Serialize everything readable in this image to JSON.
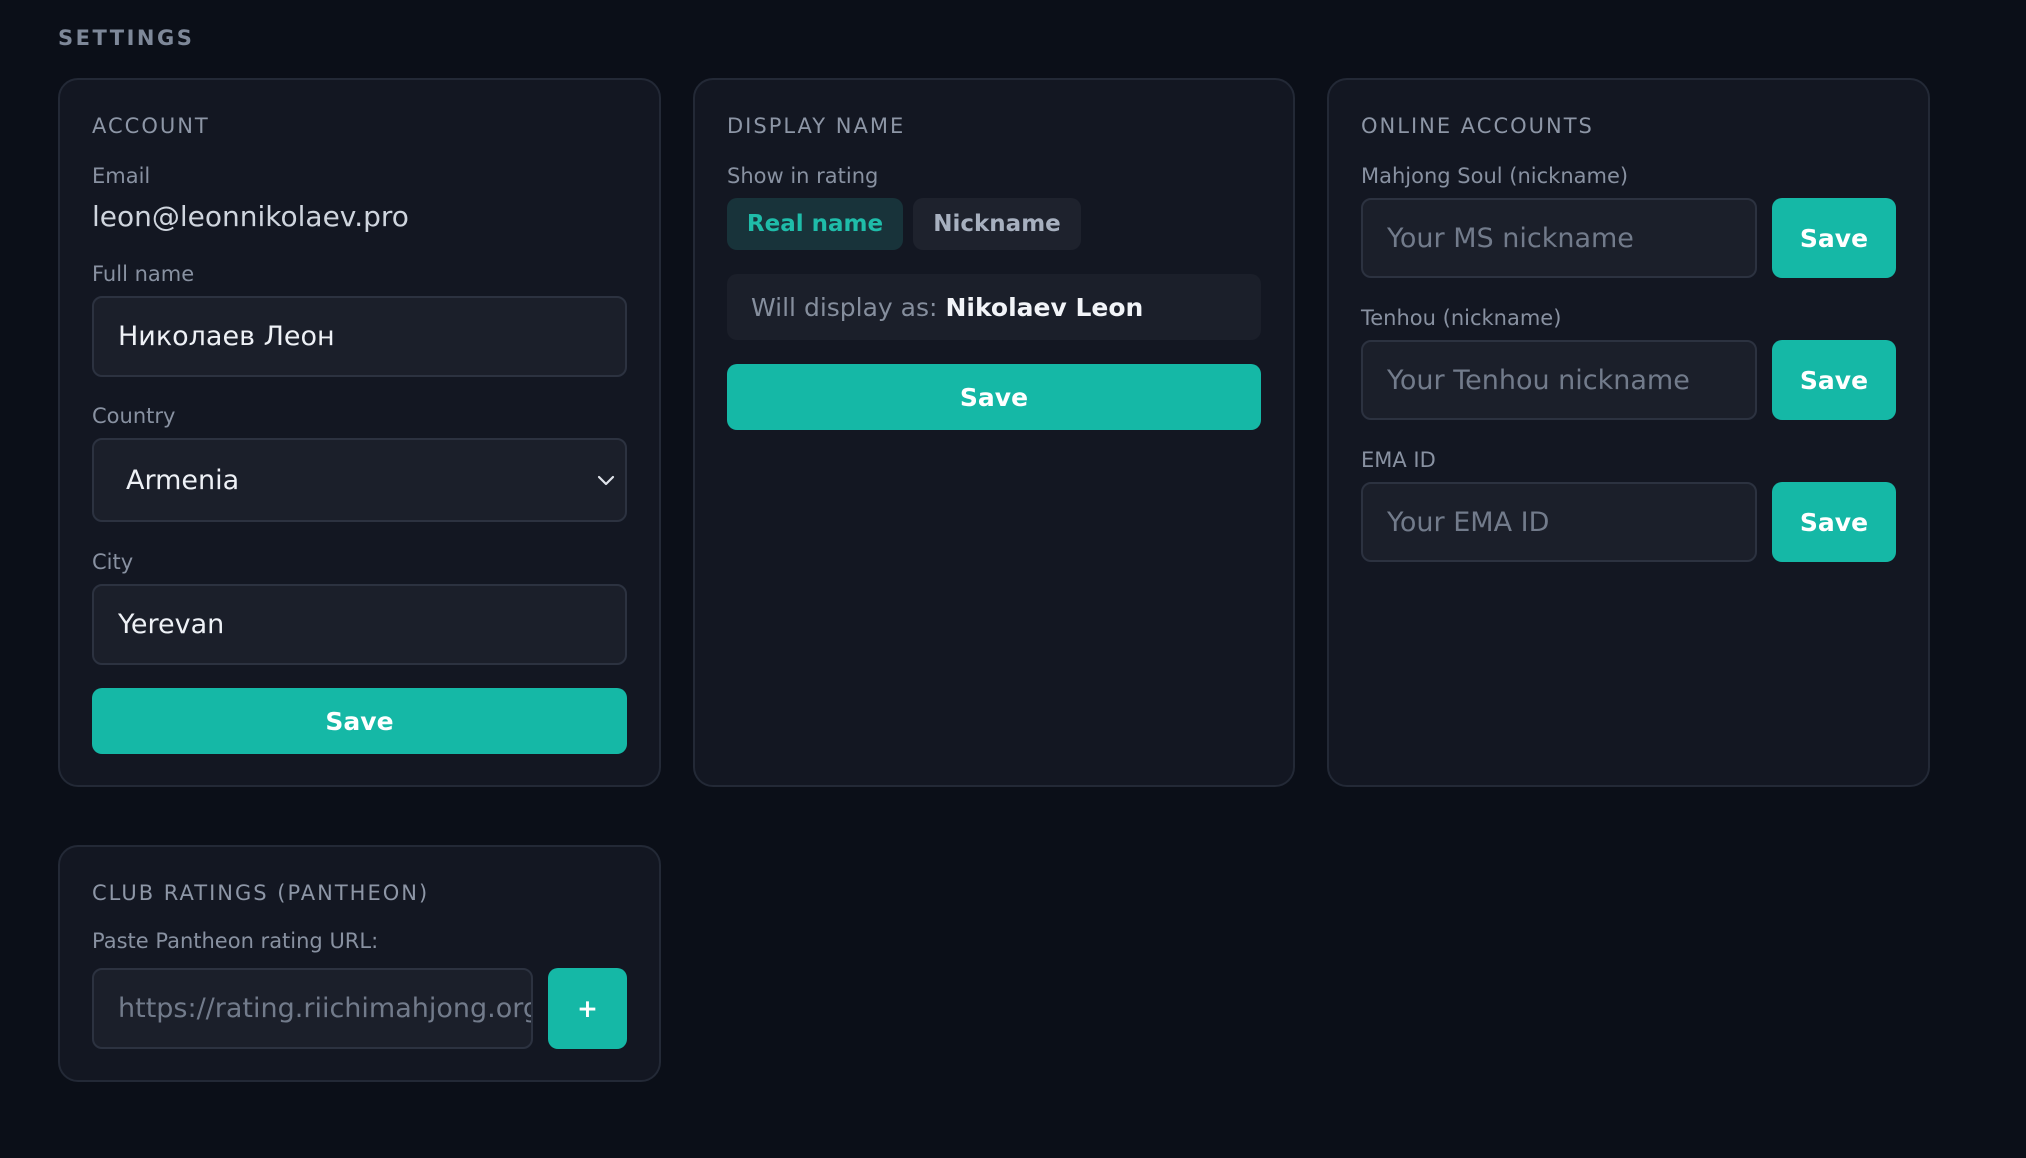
{
  "page": {
    "title": "SETTINGS"
  },
  "account": {
    "title": "ACCOUNT",
    "email_label": "Email",
    "email_value": "leon@leonnikolaev.pro",
    "fullname_label": "Full name",
    "fullname_value": "Николаев Леон",
    "country_label": "Country",
    "country_value": "Armenia",
    "city_label": "City",
    "city_value": "Yerevan",
    "save_label": "Save"
  },
  "display_name": {
    "title": "DISPLAY NAME",
    "show_label": "Show in rating",
    "options": [
      "Real name",
      "Nickname"
    ],
    "selected": "Real name",
    "preview_prefix": "Will display as:",
    "preview_value": "Nikolaev Leon",
    "save_label": "Save"
  },
  "online_accounts": {
    "title": "ONLINE ACCOUNTS",
    "ms_label": "Mahjong Soul (nickname)",
    "ms_placeholder": "Your MS nickname",
    "tenhou_label": "Tenhou (nickname)",
    "tenhou_placeholder": "Your Tenhou nickname",
    "ema_label": "EMA ID",
    "ema_placeholder": "Your EMA ID",
    "save_label": "Save"
  },
  "club_ratings": {
    "title": "CLUB RATINGS (PANTHEON)",
    "url_label": "Paste Pantheon rating URL:",
    "url_placeholder": "https://rating.riichimahjong.org",
    "add_label": "+"
  },
  "colors": {
    "background": "#0b0f18",
    "card": "#131722",
    "accent": "#15b8a6"
  }
}
